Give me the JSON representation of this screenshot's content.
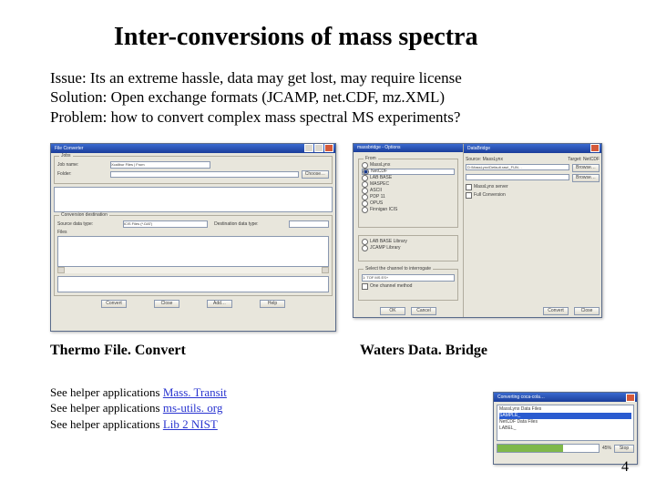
{
  "title": "Inter-conversions of mass spectra",
  "lines": {
    "issue": "Issue: Its an extreme hassle, data may get lost, may require license",
    "solution": "Solution: Open exchange formats (JCAMP, net.CDF, mz.XML)",
    "problem": "Problem: how to convert complex mass spectral MS experiments?"
  },
  "thermo": {
    "window_title": "File Converter",
    "jobs_label": "Jobs",
    "jobname_label": "Job name:",
    "jobname_value": "Xcalibur Files | From",
    "folder_label": "Folder:",
    "choose": "Choose…",
    "convert_dest_label": "Conversion destination",
    "source_type_label": "Source data type:",
    "source_type_value": "ICIS Files (*.DAT)",
    "dest_type_label": "Destination data type:",
    "files_label": "Files",
    "buttons": {
      "convert": "Convert",
      "close": "Close",
      "add": "Add…",
      "help": "Help"
    }
  },
  "mbo": {
    "title_left": "massbridge - Options",
    "from_label": "From",
    "from_options": [
      "MassLynx",
      "NetCDF",
      "LAB BASE",
      "MASPEC",
      "ASCII",
      "PDP 11",
      "OPUS",
      "Finnigan ICIS"
    ],
    "from_selected": "NetCDF",
    "from_more": [
      "LAB BASE Library",
      "JCAMP Library"
    ],
    "db_title": "DataBridge",
    "source_label": "Source: MassLynx",
    "target_label": "Target: NetCDF",
    "source_path": "D:\\MassLynx\\Default.raw\\_FUN…",
    "browse": "Browse…",
    "check1": "MassLynx server",
    "check2": "Full Conversion",
    "convert": "Convert",
    "close": "Close",
    "panel2_title": "Select the channel to interrogate",
    "sel1": "1: TOF MS ES+",
    "chk_extra": "One channel method",
    "ok": "OK",
    "cancel": "Cancel"
  },
  "progress": {
    "title": "Converting coca-cola…",
    "rows": [
      "MassLynx Data Files",
      "SAMPLE_",
      "NetCDF Data Files",
      "LABEL_"
    ],
    "pct": "45%",
    "stop": "Stop"
  },
  "captions": {
    "left": "Thermo File. Convert",
    "right": "Waters Data. Bridge"
  },
  "refs": {
    "prefix": "See helper applications ",
    "links": [
      "Mass. Transit",
      "ms-utils. org",
      "Lib 2 NIST"
    ]
  },
  "page_number": "4"
}
